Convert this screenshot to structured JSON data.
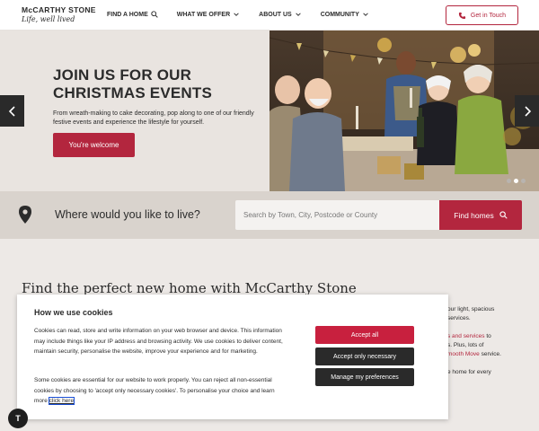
{
  "header": {
    "logo_name": "McCARTHY STONE",
    "logo_tagline": "Life, well lived",
    "nav": [
      {
        "label": "FIND A HOME",
        "icon": "search-icon"
      },
      {
        "label": "WHAT WE OFFER",
        "icon": "chevron-down-icon"
      },
      {
        "label": "ABOUT US",
        "icon": "chevron-down-icon"
      },
      {
        "label": "COMMUNITY",
        "icon": "chevron-down-icon"
      }
    ],
    "contact_label": "Get in Touch"
  },
  "hero": {
    "title_line1": "JOIN US FOR OUR",
    "title_line2": "CHRISTMAS EVENTS",
    "text": "From wreath-making to cake decorating, pop along to one of our friendly festive events and experience the lifestyle for yourself.",
    "cta_label": "You're welcome",
    "slide_count": 3,
    "active_slide": 2
  },
  "search": {
    "label": "Where would you like to live?",
    "placeholder": "Search by Town, City, Postcode or County",
    "button_label": "Find homes"
  },
  "content": {
    "title": "Find the perfect new home with McCarthy Stone",
    "side_lines": [
      {
        "text": "our light, spacious",
        "link": false
      },
      {
        "text": "services.",
        "link": false
      },
      {
        "text": "",
        "link": false
      },
      {
        "text": "s and services",
        "link": true,
        "suffix": " to"
      },
      {
        "text": "s. Plus, lots of",
        "link": false
      },
      {
        "text": "mooth Move",
        "link": true,
        "suffix": " service."
      },
      {
        "text": "",
        "link": false
      },
      {
        "text": "e home for every",
        "link": false
      }
    ]
  },
  "cookie": {
    "title": "How we use cookies",
    "paragraph1": "Cookies can read, store and write information on your web browser and device. This information may include things like your IP address and browsing activity. We use cookies to deliver content, maintain security, personalise the website, improve your experience and for marketing.",
    "paragraph2": "Some cookies are essential for our website to work properly. You can reject all non-essential cookies by choosing to 'accept only necessary cookies'. To personalise your choice and learn more ",
    "link_label": "click here",
    "accept_all": "Accept all",
    "accept_necessary": "Accept only necessary",
    "manage_prefs": "Manage my preferences"
  },
  "widget": {
    "label": "T"
  },
  "colors": {
    "brand": "#b3263e",
    "accept": "#c8203e",
    "dark": "#2a2a2a",
    "hero_bg": "#e9e4e0",
    "search_bg": "#d9d3cd"
  }
}
